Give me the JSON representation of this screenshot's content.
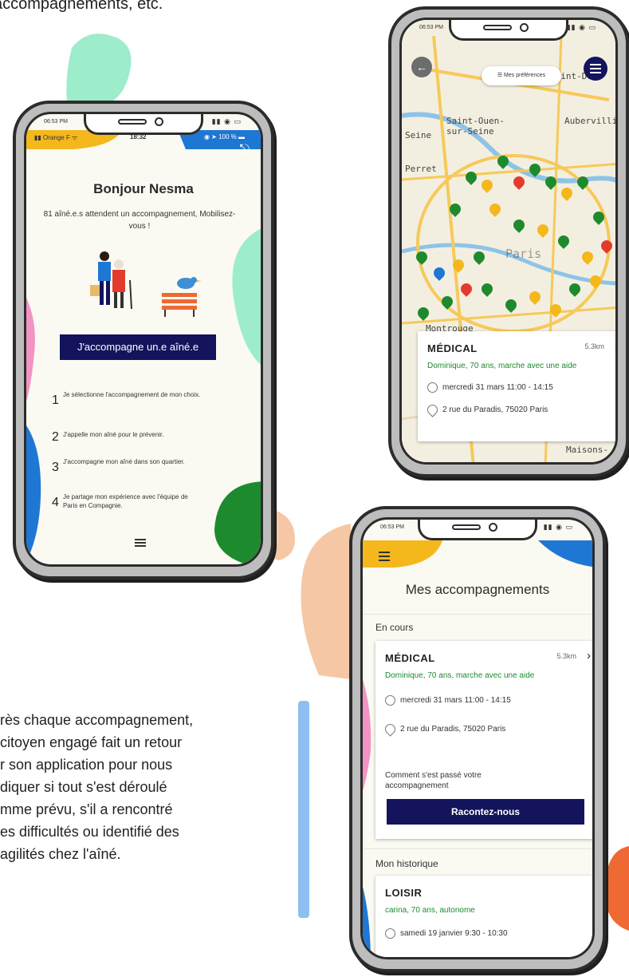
{
  "intro_text": "accompagnements, etc.",
  "colors": {
    "navy": "#13145c",
    "green": "#1e8a2e",
    "yellow": "#f4b81c",
    "mint": "#9deccc",
    "pink": "#f294c3",
    "blue": "#1f77d4",
    "peach": "#f6c7a4",
    "orange": "#ee6a32",
    "light_blue": "#8fbff2"
  },
  "status_time": "06:53 PM",
  "phone1": {
    "carrier": "Orange F",
    "clock": "18:32",
    "battery": "100 %",
    "logout_icon": "logout-icon",
    "greeting": "Bonjour Nesma",
    "subtitle": "81 aîné.e.s attendent un accompagnement, Mobilisez-vous !",
    "cta": "J'accompagne un.e aîné.e",
    "steps": [
      {
        "num": "1",
        "text": "Je sélectionne l'accompagnement de mon choix."
      },
      {
        "num": "2",
        "text": "J'appelle mon aîné pour le prévenir."
      },
      {
        "num": "3",
        "text": "J'accompagne mon aîné dans son quartier."
      },
      {
        "num": "4",
        "text": "Je partage mon expérience avec l'équipe de Paris en Compagnie."
      }
    ]
  },
  "phone2": {
    "preferences": "Mes préférences",
    "map_labels": [
      "Saint-De",
      "Saint-Ouen-",
      "sur-Seine",
      "Aubervilli",
      "Seine",
      "Perret",
      "Paris",
      "Montrouge",
      "Maisons-"
    ],
    "card": {
      "category": "MÉDICAL",
      "distance": "5.3km",
      "person": "Dominique, 70 ans, marche avec une aide",
      "datetime": "mercredi 31 mars 11:00 - 14:15",
      "address": "2 rue du Paradis, 75020 Paris"
    }
  },
  "phone3": {
    "title": "Mes accompagnements",
    "en_cours": "En cours",
    "card": {
      "category": "MÉDICAL",
      "distance": "5.3km",
      "person": "Dominique, 70 ans, marche avec une aide",
      "datetime": "mercredi 31 mars 11:00 - 14:15",
      "address": "2 rue du Paradis, 75020 Paris",
      "comment": "Comment s'est passé votre accompagnement",
      "cta": "Racontez-nous"
    },
    "historique": "Mon historique",
    "history_card": {
      "category": "LOISIR",
      "person": "carina, 70 ans, autonome",
      "datetime": "samedi 19 janvier 9:30 - 10:30"
    }
  },
  "paragraph_lines": [
    "rès chaque accompagnement,",
    "citoyen engagé fait un retour",
    "r son application pour nous",
    "diquer si tout s'est déroulé",
    "mme prévu, s'il a rencontré",
    "es difficultés ou identifié des",
    "agilités chez l'aîné."
  ]
}
